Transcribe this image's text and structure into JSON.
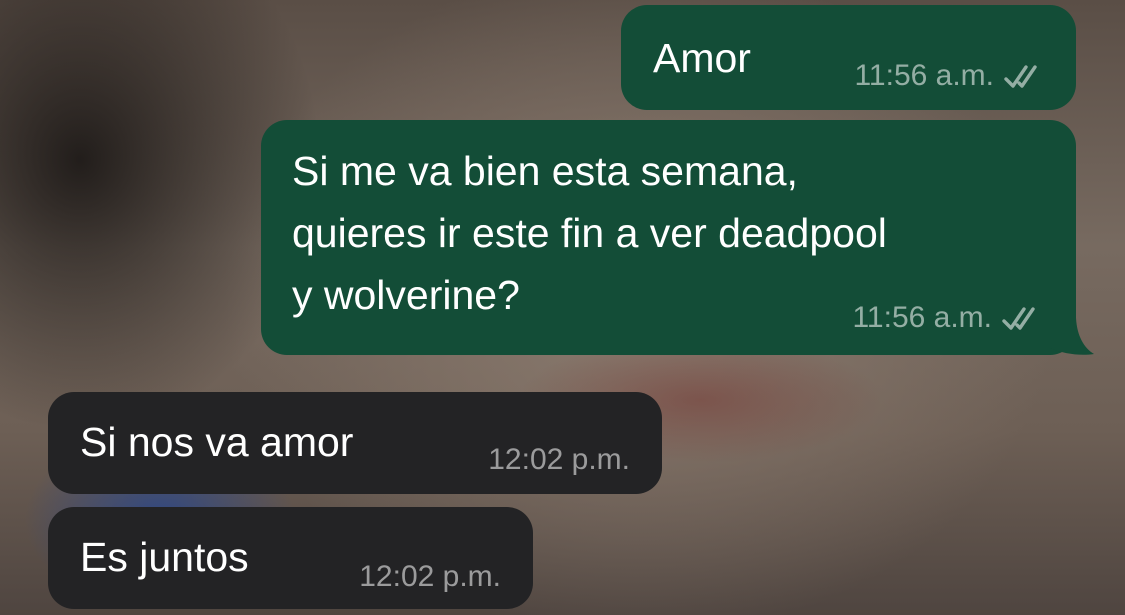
{
  "messages": [
    {
      "direction": "outgoing",
      "text": "Amor",
      "time": "11:56 a.m.",
      "status_icon": "double-check-icon"
    },
    {
      "direction": "outgoing",
      "text": "Si me va bien esta semana,\nquieres ir este fin a ver deadpool\ny wolverine?",
      "time": "11:56 a.m.",
      "status_icon": "double-check-icon"
    },
    {
      "direction": "incoming",
      "text": "Si nos va amor",
      "time": "12:02 p.m."
    },
    {
      "direction": "incoming",
      "text": "Es juntos",
      "time": "12:02 p.m."
    }
  ],
  "colors": {
    "outgoing_bubble": "#134d37",
    "incoming_bubble": "#232325",
    "text": "#ffffff",
    "meta_text": "rgba(255,255,255,0.55)"
  }
}
